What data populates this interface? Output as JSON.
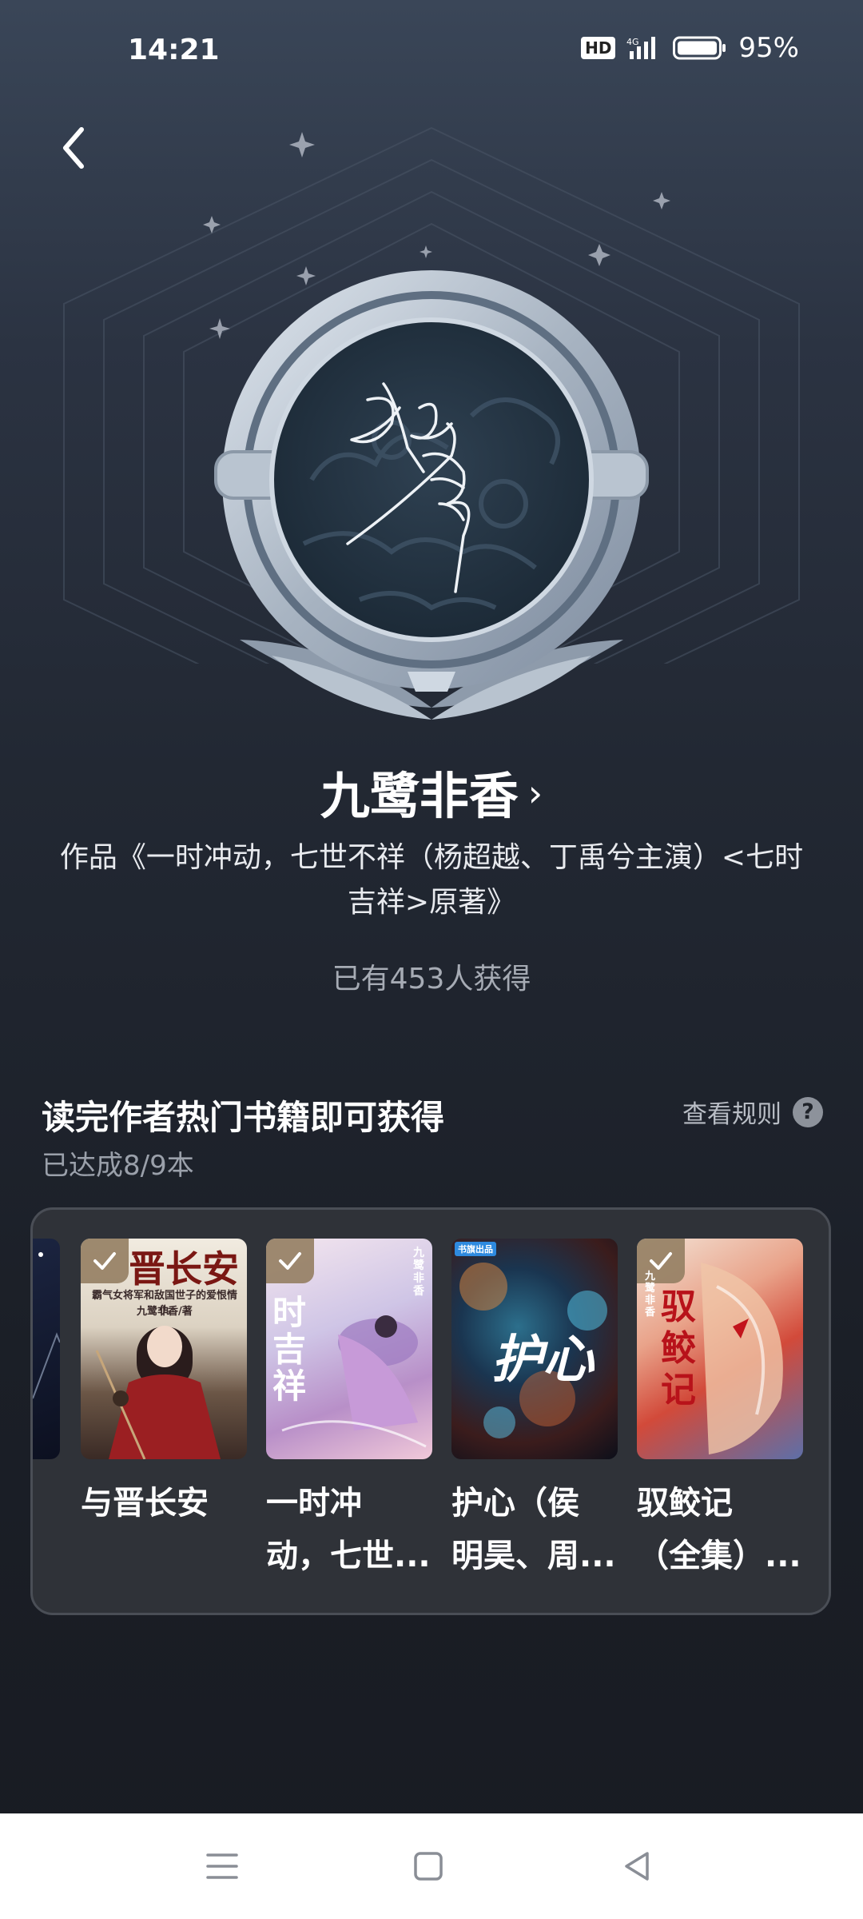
{
  "status_bar": {
    "time": "14:21",
    "hd": "HD",
    "network": "4G",
    "battery_percent": "95%",
    "battery_level": 0.95
  },
  "nav": {
    "back_icon": "chevron-left-icon"
  },
  "medal": {
    "signature_icon": "author-signature-medal"
  },
  "author": {
    "name": "九鹭非香",
    "chevron": "›",
    "works_description": "作品《一时冲动，七世不祥（杨超越、丁禹兮主演）<七时吉祥>原著》",
    "obtained_count": "已有453人获得"
  },
  "task": {
    "title": "读完作者热门书籍即可获得",
    "progress": "已达成8/9本",
    "rules_label": "查看规则",
    "help_icon": "?"
  },
  "books": [
    {
      "title_line1": "与晋长安",
      "title_line2": "",
      "cover_title": "晋长安",
      "cover_subtitle": "霸气女将军和敌国世子的爱恨情仇",
      "cover_author": "九鹭非香/著",
      "completed": true
    },
    {
      "title_line1": "一时冲",
      "title_line2": "动，七世...",
      "cover_title": "时吉祥",
      "cover_author": "九鹭非香",
      "completed": true
    },
    {
      "title_line1": "护心（侯",
      "title_line2": "明昊、周...",
      "cover_title": "护心",
      "cover_tag": "书旗出品",
      "completed": false
    },
    {
      "title_line1": "驭鲛记",
      "title_line2": "（全集）...",
      "cover_title": "驭鲛记",
      "cover_author": "九鹭非香",
      "completed": true
    }
  ],
  "system_nav": {
    "menu_icon": "menu-icon",
    "home_icon": "home-square-icon",
    "back_icon": "back-triangle-icon"
  }
}
